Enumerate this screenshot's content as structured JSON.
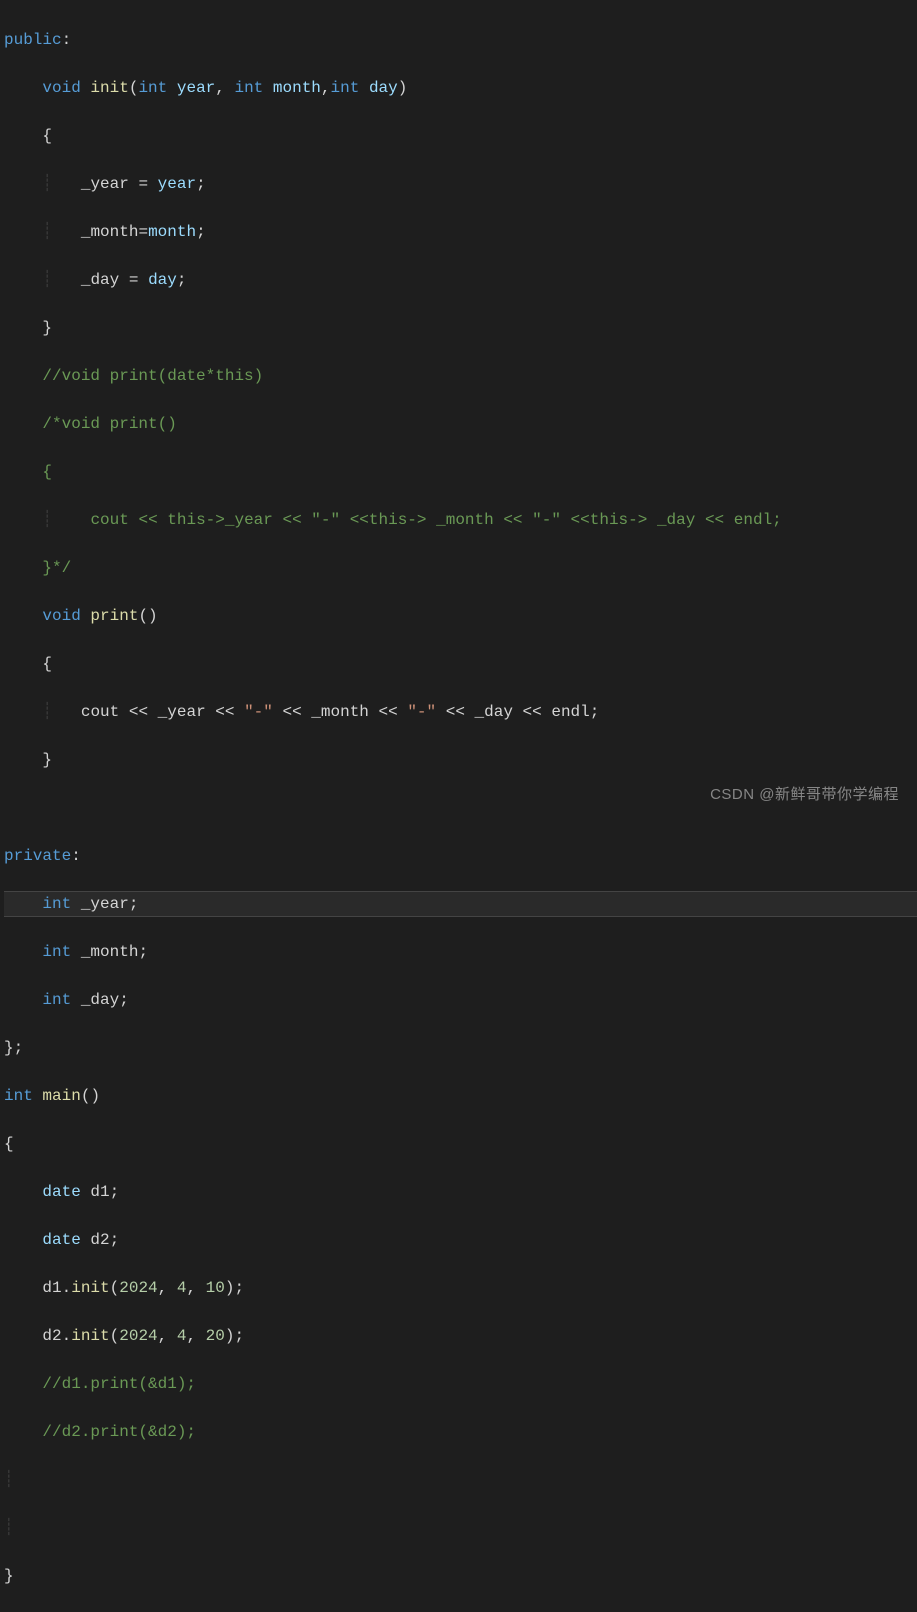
{
  "code": {
    "kw_public": "public",
    "kw_private": "private",
    "kw_void": "void",
    "kw_int": "int",
    "colon": ":",
    "fn_init": "init",
    "fn_print": "print",
    "fn_main": "main",
    "p_open": "(",
    "p_close": ")",
    "b_open": "{",
    "b_close": "}",
    "param_year": "year",
    "param_month": "month",
    "param_day": "day",
    "comma": ",",
    "comma_sp": ", ",
    "semi": ";",
    "eq": " = ",
    "eq_ns": "=",
    "m_year": "_year",
    "m_month": "_month",
    "m_day": "_day",
    "cmt_print_this": "//void print(date*this)",
    "cmt_block_open": "/*void print()",
    "cmt_block_brace": "{",
    "cmt_cout_this": "    cout << this->_year << \"-\" <<this-> _month << \"-\" <<this-> _day << endl;",
    "cmt_block_close": "}*/",
    "cout": "cout",
    "ltlt": " << ",
    "dash_str": "\"-\"",
    "endl": "endl",
    "close_class": "};",
    "type_date": "date",
    "var_d1": "d1",
    "var_d2": "d2",
    "dot": ".",
    "arg1_y": "2024",
    "arg1_m": "4",
    "arg1_d": "10",
    "arg2_d": "20",
    "cmt_d1": "//d1.print(&d1);",
    "cmt_d2": "//d2.print(&d2);"
  },
  "watermark": "CSDN @新鲜哥带你学编程"
}
